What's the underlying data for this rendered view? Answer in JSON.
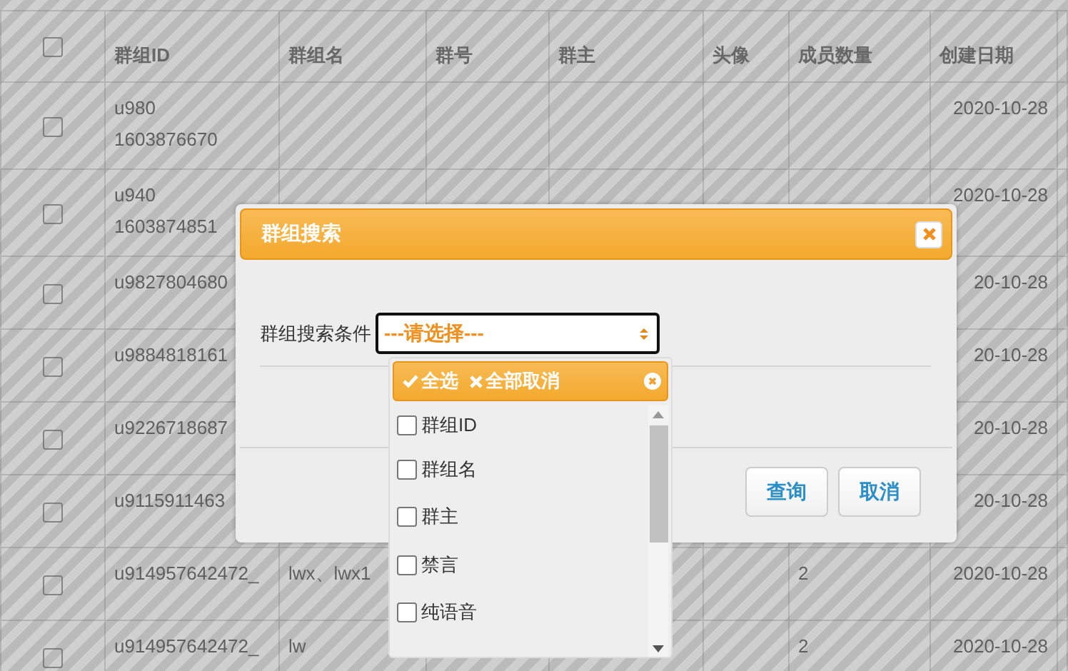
{
  "table": {
    "select_all_checked": false,
    "columns": [
      "群组ID",
      "群组名",
      "群号",
      "群主",
      "头像",
      "成员数量",
      "创建日期"
    ],
    "rows": [
      {
        "checked": false,
        "id": [
          "u980",
          "1603876670"
        ],
        "name": "",
        "members": "",
        "date": "2020-10-28"
      },
      {
        "checked": false,
        "id": [
          "u940",
          "1603874851"
        ],
        "name": "",
        "members": "",
        "date": "2020-10-28"
      },
      {
        "checked": false,
        "id": [
          "u9827804680"
        ],
        "name": "",
        "members": "",
        "date": "20-10-28"
      },
      {
        "checked": false,
        "id": [
          "u9884818161"
        ],
        "name": "",
        "members": "",
        "date": "20-10-28"
      },
      {
        "checked": false,
        "id": [
          "u9226718687"
        ],
        "name": "",
        "members": "",
        "date": "20-10-28"
      },
      {
        "checked": false,
        "id": [
          "u9115911463"
        ],
        "name": "",
        "members": "",
        "date": "20-10-28"
      },
      {
        "checked": false,
        "id": [
          "u914957642472_"
        ],
        "name": "lwx、lwx1",
        "members": "2",
        "date": "2020-10-28"
      },
      {
        "checked": false,
        "id": [
          "u914957642472_"
        ],
        "name": "lw",
        "members": "2",
        "date": "2020-10-28"
      }
    ]
  },
  "dialog": {
    "title": "群组搜索",
    "field_label": "群组搜索条件",
    "select_placeholder": "---请选择---",
    "dropdown": {
      "select_all": "全选",
      "deselect_all": "全部取消",
      "options": [
        {
          "label": "群组ID",
          "checked": false
        },
        {
          "label": "群组名",
          "checked": false
        },
        {
          "label": "群主",
          "checked": false
        },
        {
          "label": "禁言",
          "checked": false
        },
        {
          "label": "纯语音",
          "checked": false
        }
      ]
    },
    "buttons": [
      "查询",
      "取消"
    ]
  }
}
